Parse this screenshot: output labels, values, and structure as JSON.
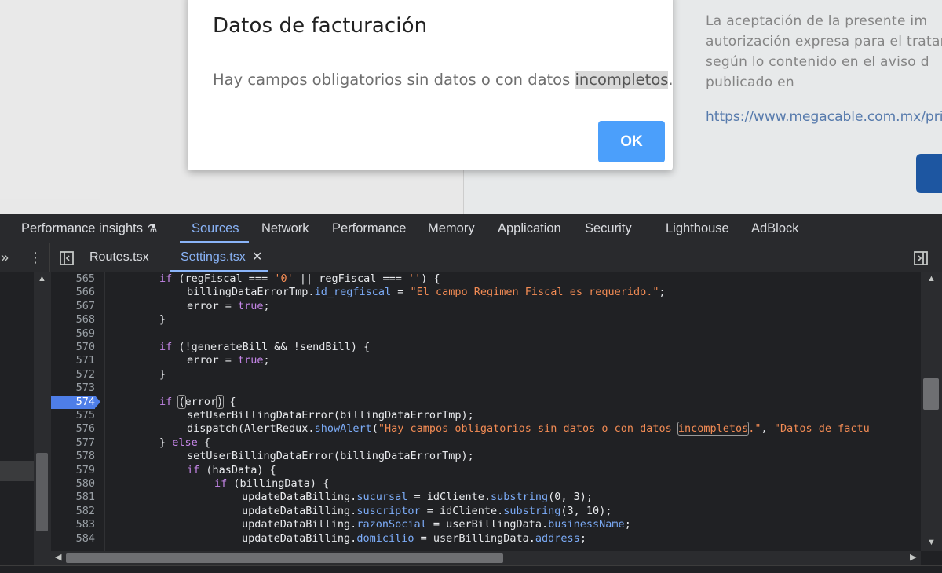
{
  "page": {
    "privacy_lines": [
      "La aceptación de la presente im",
      "autorización expresa para el tratamie",
      "según lo contenido en el aviso d",
      "publicado en"
    ],
    "privacy_link": "https://www.megacable.com.mx/priv"
  },
  "dialog": {
    "title": "Datos de facturación",
    "message_before": "Hay campos obligatorios sin datos o con datos ",
    "message_highlight": "incompletos",
    "message_after": ".",
    "ok_label": "OK",
    "ok_color": "#4b9ffb"
  },
  "devtools": {
    "panel_tabs": [
      "Performance insights",
      "Sources",
      "Network",
      "Performance",
      "Memory",
      "Application",
      "Security",
      "Lighthouse",
      "AdBlock"
    ],
    "active_panel": "Sources",
    "performance_insights_icon": "flask-icon",
    "accent_color": "#8ab4f8",
    "file_tabs": [
      "Routes.tsx",
      "Settings.tsx"
    ],
    "active_file": "Settings.tsx",
    "breakpoint_line": "574",
    "line_numbers": [
      "565",
      "566",
      "567",
      "568",
      "569",
      "570",
      "571",
      "572",
      "573",
      "574",
      "575",
      "576",
      "577",
      "578",
      "579",
      "580",
      "581",
      "582",
      "583",
      "584"
    ],
    "code": {
      "l565": [
        "if",
        " (regFiscal === ",
        "'0'",
        " || regFiscal === ",
        "''",
        ") {"
      ],
      "l566": [
        "billingDataErrorTmp.",
        "id_regfiscal",
        " = ",
        "\"El campo Regimen Fiscal es requerido.\"",
        ";"
      ],
      "l567": [
        "error = ",
        "true",
        ";"
      ],
      "l568": "}",
      "l570": [
        "if",
        " (!generateBill && !sendBill) {"
      ],
      "l571": [
        "error = ",
        "true",
        ";"
      ],
      "l572": "}",
      "l574": [
        "if",
        " ",
        "(",
        "error",
        ")",
        " {"
      ],
      "l575": "setUserBillingDataError(billingDataErrorTmp);",
      "l576": [
        "dispatch(AlertRedux.",
        "showAlert",
        "(",
        "\"Hay campos obligatorios sin datos o con datos ",
        "incompletos",
        ".\"",
        ", ",
        "\"Datos de factu"
      ],
      "l577": [
        "} ",
        "else",
        " {"
      ],
      "l578": "setUserBillingDataError(billingDataErrorTmp);",
      "l579": [
        "if",
        " (hasData) {"
      ],
      "l580": [
        "if",
        " (billingData) {"
      ],
      "l581": [
        "updateDataBilling.",
        "sucursal",
        " = idCliente.",
        "substring",
        "(0, 3);"
      ],
      "l582": [
        "updateDataBilling.",
        "suscriptor",
        " = idCliente.",
        "substring",
        "(3, 10);"
      ],
      "l583": [
        "updateDataBilling.",
        "razonSocial",
        " = userBillingData.",
        "businessName",
        ";"
      ],
      "l584": [
        "updateDataBilling.",
        "domicilio",
        " = userBillingData.",
        "address",
        ";"
      ]
    }
  }
}
